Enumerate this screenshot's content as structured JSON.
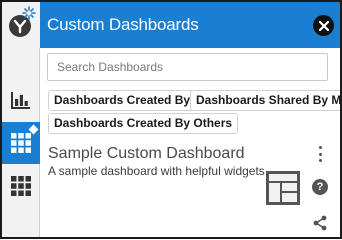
{
  "header": {
    "title": "Custom Dashboards"
  },
  "search": {
    "placeholder": "Search Dashboards"
  },
  "filters": [
    {
      "label": "Dashboards Created By Me"
    },
    {
      "label": "Dashboards Shared By Me"
    },
    {
      "label": "Dashboards Created By Others"
    }
  ],
  "dashboards": [
    {
      "title": "Sample Custom Dashboard",
      "description": "A sample dashboard with helpful widgets."
    }
  ],
  "sidebar": {
    "items": [
      {
        "icon": "bar-chart-icon",
        "active": false
      },
      {
        "icon": "add-dashboard-grid-icon",
        "active": true
      },
      {
        "icon": "grid-icon",
        "active": false
      }
    ]
  },
  "colors": {
    "accent": "#1a7fd1",
    "close": "#111111",
    "rail": "#f2f2f2"
  }
}
